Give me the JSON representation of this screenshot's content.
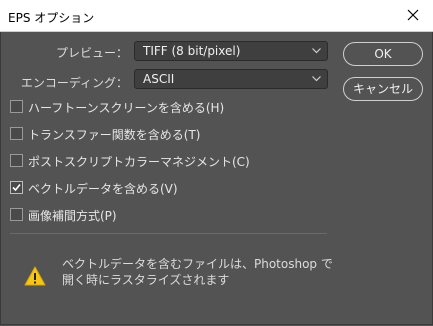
{
  "window": {
    "title": "EPS オプション",
    "close_icon": "close-icon"
  },
  "preview": {
    "label": "プレビュー：",
    "value": "TIFF (8 bit/pixel)"
  },
  "encoding": {
    "label": "エンコーディング：",
    "value": "ASCII"
  },
  "buttons": {
    "ok": "OK",
    "cancel": "キャンセル"
  },
  "options": [
    {
      "label": "ハーフトーンスクリーンを含める(H)",
      "checked": false
    },
    {
      "label": "トランスファー関数を含める(T)",
      "checked": false
    },
    {
      "label": "ポストスクリプトカラーマネジメント(C)",
      "checked": false
    },
    {
      "label": "ベクトルデータを含める(V)",
      "checked": true
    },
    {
      "label": "画像補間方式(P)",
      "checked": false
    }
  ],
  "warning": {
    "icon": "warning-icon",
    "line1": "ベクトルデータを含むファイルは、Photoshop で",
    "line2": "開く時にラスタライズされます"
  },
  "colors": {
    "background": "#535353",
    "warning": "#f5c518"
  }
}
